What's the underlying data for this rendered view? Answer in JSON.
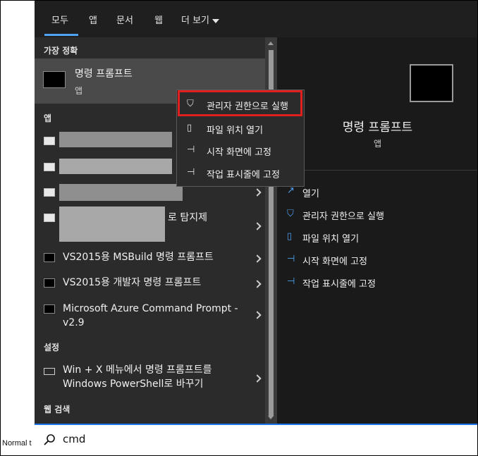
{
  "status_bar": {
    "text": "Normal t"
  },
  "tabs": [
    {
      "label": "모두"
    },
    {
      "label": "앱"
    },
    {
      "label": "문서"
    },
    {
      "label": "웹"
    },
    {
      "label": "더 보기"
    }
  ],
  "sections": {
    "best_match": "가장 정확",
    "apps": "앱",
    "settings": "설정",
    "web_search": "웹 검색"
  },
  "best_match": {
    "title": "명령 프롬프트",
    "subtitle": "앱"
  },
  "apps": [
    {
      "label": ""
    },
    {
      "label": ""
    },
    {
      "label": ""
    },
    {
      "label": "로 탐지제"
    },
    {
      "label": "VS2015용 MSBuild 명령 프롬프트"
    },
    {
      "label": "VS2015용 개발자 명령 프롬프트"
    },
    {
      "label": "Microsoft Azure Command Prompt - v2.9"
    }
  ],
  "settings_item": {
    "label": "Win + X 메뉴에서 명령 프롬프트를 Windows PowerShell로 바꾸기"
  },
  "context_menu": [
    {
      "label": "관리자 권한으로 실행",
      "icon": "shield-icon"
    },
    {
      "label": "파일 위치 열기",
      "icon": "folder-icon"
    },
    {
      "label": "시작 화면에 고정",
      "icon": "pin-icon"
    },
    {
      "label": "작업 표시줄에 고정",
      "icon": "pin-icon"
    }
  ],
  "preview": {
    "title": "명령 프롬프트",
    "subtitle": "앱",
    "actions": [
      {
        "label": "열기",
        "icon": "open-icon"
      },
      {
        "label": "관리자 권한으로 실행",
        "icon": "shield-icon"
      },
      {
        "label": "파일 위치 열기",
        "icon": "folder-icon"
      },
      {
        "label": "시작 화면에 고정",
        "icon": "pin-icon"
      },
      {
        "label": "작업 표시줄에 고정",
        "icon": "pin-icon"
      }
    ]
  },
  "search": {
    "value": "cmd"
  },
  "colors": {
    "accent": "#4ea2f2",
    "highlight_box": "#e01f1f"
  }
}
